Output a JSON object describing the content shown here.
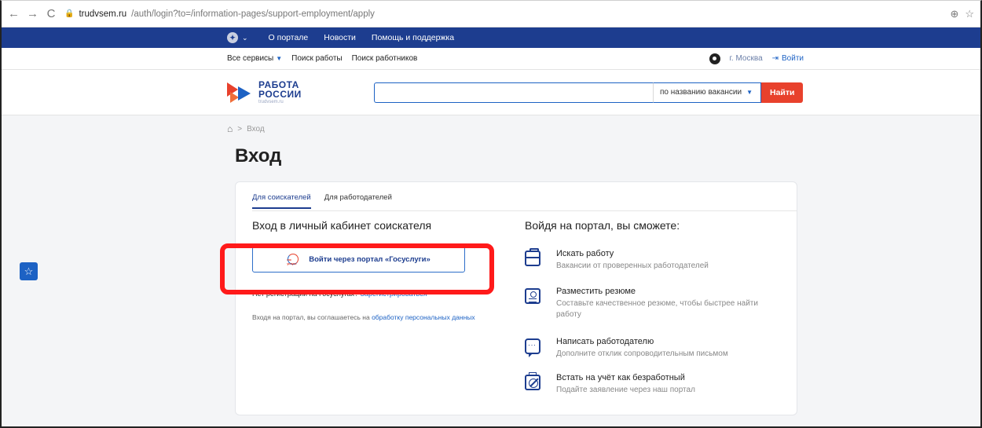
{
  "browser": {
    "back": "←",
    "forward": "→",
    "reload": "C",
    "url_host": "trudvsem.ru",
    "url_path": "/auth/login?to=/information-pages/support-employment/apply",
    "zoom": "⊕",
    "star": "☆"
  },
  "topbar": {
    "items": [
      "О портале",
      "Новости",
      "Помощь и поддержка"
    ]
  },
  "servicebar": {
    "all_services": "Все сервисы",
    "job_search": "Поиск работы",
    "worker_search": "Поиск работников",
    "city": "г. Москва",
    "login": "Войти"
  },
  "logo": {
    "line1": "РАБОТА",
    "line2": "РОССИИ",
    "line3": "trudvsem.ru"
  },
  "search": {
    "value": "",
    "placeholder": "",
    "mode": "по названию вакансии",
    "button": "Найти"
  },
  "breadcrumb": {
    "separator": ">",
    "current": "Вход"
  },
  "page": {
    "title": "Вход"
  },
  "tabs": [
    {
      "label": "Для соискателей",
      "active": true
    },
    {
      "label": "Для работодателей",
      "active": false
    }
  ],
  "login": {
    "title": "Вход в личный кабинет соискателя",
    "gos_button": "Войти через портал «Госуслуги»",
    "gos_icon_text": "гос услуги",
    "noreg_text": "Нет регистрации на Госуслугах? ",
    "noreg_link": "Зарегистрироваться",
    "agree_text": "Входя на портал, вы соглашаетесь на ",
    "agree_link": "обработку персональных данных"
  },
  "benefits": {
    "title": "Войдя на портал, вы сможете:",
    "items": [
      {
        "icon": "briefcase-icon",
        "title": "Искать работу",
        "desc": "Вакансии от проверенных работодателей"
      },
      {
        "icon": "resume-icon",
        "title": "Разместить резюме",
        "desc": "Составьте качественное резюме, чтобы быстрее найти работу"
      },
      {
        "icon": "chat-icon",
        "title": "Написать работодателю",
        "desc": "Дополните отклик сопроводительным письмом"
      },
      {
        "icon": "unemployed-icon",
        "title": "Встать на учёт как безработный",
        "desc": "Подайте заявление через наш портал"
      }
    ]
  },
  "colors": {
    "brand_blue": "#1d3d8f",
    "accent_red": "#e8412c",
    "highlight": "#ff1a1a"
  }
}
